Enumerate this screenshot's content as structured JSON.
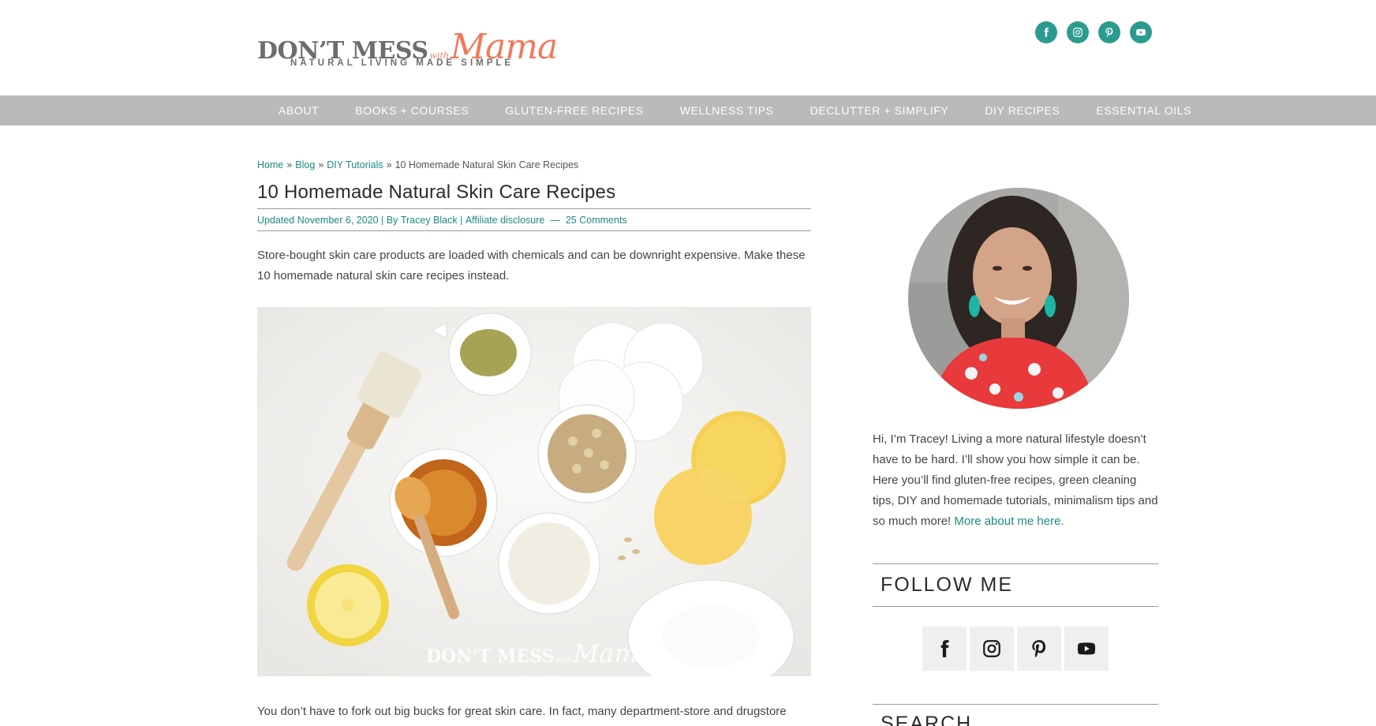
{
  "brand": {
    "logo_main": "DON’T MESS",
    "logo_with": "with",
    "logo_mama": "Mama",
    "tagline": "NATURAL LIVING MADE SIMPLE",
    "accent_color": "#f0795a",
    "teal_color": "#2c9b8f"
  },
  "social_top": [
    {
      "icon": "facebook-icon"
    },
    {
      "icon": "instagram-icon"
    },
    {
      "icon": "pinterest-icon"
    },
    {
      "icon": "youtube-icon"
    }
  ],
  "nav": {
    "items": [
      {
        "label": "ABOUT"
      },
      {
        "label": "BOOKS + COURSES"
      },
      {
        "label": "GLUTEN-FREE RECIPES"
      },
      {
        "label": "WELLNESS TIPS"
      },
      {
        "label": "DECLUTTER + SIMPLIFY"
      },
      {
        "label": "DIY RECIPES"
      },
      {
        "label": "ESSENTIAL OILS"
      }
    ]
  },
  "breadcrumb": {
    "home": "Home",
    "blog": "Blog",
    "category": "DIY Tutorials",
    "current": "10 Homemade Natural Skin Care Recipes",
    "separator": "»"
  },
  "article": {
    "title": "10 Homemade Natural Skin Care Recipes",
    "meta_updated": "Updated November 6, 2020 | By",
    "meta_author": "Tracey Black",
    "meta_divider": "|",
    "meta_disclosure": "Affiliate disclosure",
    "meta_dash": "—",
    "meta_comments": "25 Comments",
    "intro": "Store-bought skin care products are loaded with chemicals and can be downright expensive. Make these 10 homemade natural skin care recipes instead.",
    "hero_watermark_main": "DON’T MESS",
    "hero_watermark_with": "with",
    "hero_watermark_mama": "Mama",
    "paragraph": "You don’t have to fork out big bucks for great skin care. In fact, many department-store and drugstore"
  },
  "sidebar": {
    "bio": "Hi, I’m Tracey! Living a more natural lifestyle doesn’t have to be hard. I’ll show you how simple it can be. Here you’ll find gluten-free recipes, green cleaning tips, DIY and homemade tutorials, minimalism tips and so much more!",
    "bio_link": "More about me here.",
    "follow_heading": "FOLLOW ME",
    "follow_icons": [
      "facebook-icon",
      "instagram-icon",
      "pinterest-icon",
      "youtube-icon"
    ],
    "search_heading": "SEARCH"
  }
}
